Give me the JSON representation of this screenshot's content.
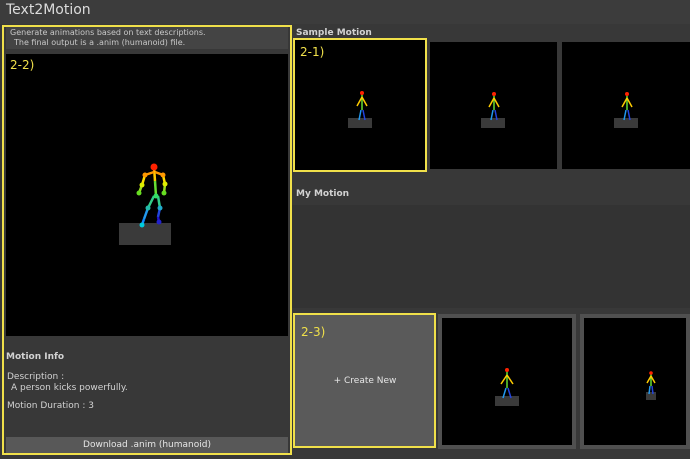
{
  "app": {
    "title": "Text2Motion"
  },
  "left_panel": {
    "description_lines": [
      "Generate animations based on text descriptions.",
      "The final output is a .anim (humanoid) file."
    ],
    "viewer_tag": "2-2)",
    "motion_info": {
      "heading": "Motion Info",
      "description_label": "Description :",
      "description_text": "A person kicks powerfully.",
      "duration_text": "Motion Duration : 3"
    },
    "download_label": "Download .anim (humanoid)"
  },
  "sample_section": {
    "heading": "Sample Motion",
    "tag": "2-1)"
  },
  "my_motion_section": {
    "heading": "My Motion",
    "tag": "2-3)",
    "create_label": "+ Create New"
  },
  "colors": {
    "highlight": "#f0e04a",
    "background": "#383838",
    "viewport": "#000000"
  }
}
